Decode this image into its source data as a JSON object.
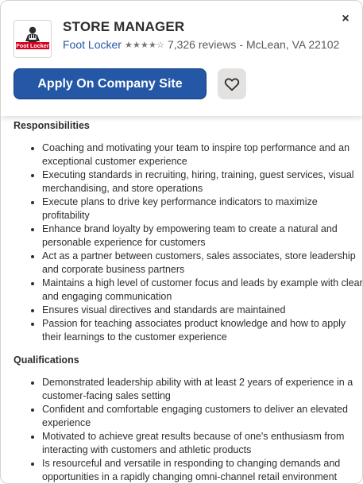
{
  "header": {
    "job_title": "STORE MANAGER",
    "company": "Foot Locker",
    "rating_stars": 4,
    "rating_max": 5,
    "reviews": "7,326 reviews",
    "separator": "-",
    "location": "McLean, VA 22102",
    "apply_label": "Apply On Company Site",
    "close_symbol": "×",
    "logo_text": "Foot Locker"
  },
  "colors": {
    "accent": "#2557a7",
    "logo_red": "#d6001c"
  },
  "sections": [
    {
      "title": "Responsibilities",
      "items": [
        "Coaching and motivating your team to inspire top performance and an exceptional customer experience",
        "Executing standards in recruiting, hiring, training, guest services, visual merchandising, and store operations",
        "Execute plans to drive key performance indicators to maximize profitability",
        "Enhance brand loyalty by empowering team to create a natural and personable experience for customers",
        "Act as a partner between customers, sales associates, store leadership and corporate business partners",
        "Maintains a high level of customer focus and leads by example with clear and engaging communication",
        "Ensures visual directives and standards are maintained",
        "Passion for teaching associates product knowledge and how to apply their learnings to the customer experience"
      ]
    },
    {
      "title": "Qualifications",
      "items": [
        "Demonstrated leadership ability with at least 2 years of experience in a customer-facing sales setting",
        "Confident and comfortable engaging customers to deliver an elevated experience",
        "Motivated to achieve great results because of one's enthusiasm from interacting with customers and athletic products",
        "Is resourceful and versatile in responding to changing demands and opportunities in a rapidly changing omni-channel retail environment"
      ]
    }
  ]
}
